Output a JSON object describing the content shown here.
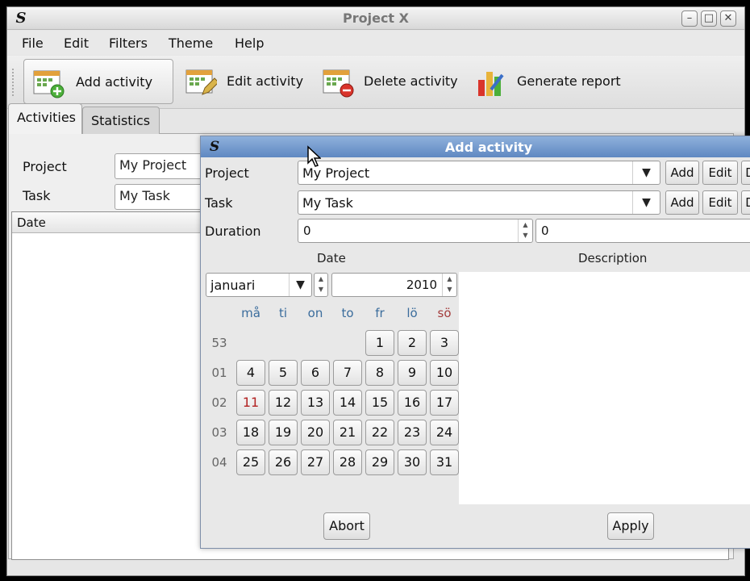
{
  "window": {
    "title": "Project X",
    "logo": "S"
  },
  "menu": [
    "File",
    "Edit",
    "Filters",
    "Theme",
    "Help"
  ],
  "toolbar": [
    {
      "label": "Add activity",
      "icon": "calendar-add-icon"
    },
    {
      "label": "Edit activity",
      "icon": "calendar-edit-icon"
    },
    {
      "label": "Delete activity",
      "icon": "calendar-delete-icon"
    },
    {
      "label": "Generate report",
      "icon": "bar-chart-icon"
    }
  ],
  "tabs": [
    "Activities",
    "Statistics"
  ],
  "filters": {
    "project_label": "Project",
    "project_value": "My Project",
    "task_label": "Task",
    "task_value": "My Task"
  },
  "list": {
    "columns": [
      "Date"
    ]
  },
  "dialog": {
    "title": "Add activity",
    "project_label": "Project",
    "project_value": "My Project",
    "task_label": "Task",
    "task_value": "My Task",
    "duration_label": "Duration",
    "duration_hours": "0",
    "duration_minutes": "0",
    "add_label": "Add",
    "edit_label": "Edit",
    "delete_label": "D",
    "date_header": "Date",
    "description_header": "Description",
    "month": "januari",
    "year": "2010",
    "weekdays": [
      "må",
      "ti",
      "on",
      "to",
      "fr",
      "lö",
      "sö"
    ],
    "weeks": [
      {
        "num": "53",
        "days": [
          "",
          "",
          "",
          "",
          "1",
          "2",
          "3"
        ]
      },
      {
        "num": "01",
        "days": [
          "4",
          "5",
          "6",
          "7",
          "8",
          "9",
          "10"
        ]
      },
      {
        "num": "02",
        "days": [
          "11",
          "12",
          "13",
          "14",
          "15",
          "16",
          "17"
        ]
      },
      {
        "num": "03",
        "days": [
          "18",
          "19",
          "20",
          "21",
          "22",
          "23",
          "24"
        ]
      },
      {
        "num": "04",
        "days": [
          "25",
          "26",
          "27",
          "28",
          "29",
          "30",
          "31"
        ]
      }
    ],
    "today": "11",
    "abort_label": "Abort",
    "apply_label": "Apply"
  },
  "colors": {
    "dialog_title_bar": "#6a90c8",
    "today": "#b22222",
    "weekday": "#3a6c9c",
    "sunday": "#a43c3c"
  }
}
